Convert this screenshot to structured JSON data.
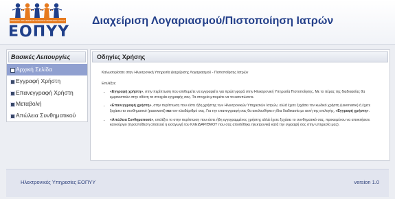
{
  "header": {
    "logo": {
      "band_text": "ΕΘΝΙΚΟΣ ΟΡΓΑΝΙΣΜΟΣ ΠΑΡΟΧΗΣ ΥΠΗΡΕΣΙΩΝ ΥΓΕΙΑΣ",
      "text": "ΕΟΠΥΥ",
      "figure_colors": [
        "#1f3f8a",
        "#e67a1e",
        "#1f3f8a",
        "#e67a1e",
        "#1f3f8a"
      ]
    },
    "title": "Διαχείριση Λογαριασμού/Πιστοποίηση Ιατρών"
  },
  "sidebar": {
    "heading": "Βασικές Λειτουργίες",
    "items": [
      {
        "label": "Αρχική Σελίδα",
        "active": true
      },
      {
        "label": "Εγγραφή Χρήστη",
        "active": false
      },
      {
        "label": "Επανεγγραφή Χρήστη",
        "active": false
      },
      {
        "label": "Μεταβολή",
        "active": false
      },
      {
        "label": "Απώλεια Συνθηματικού",
        "active": false
      }
    ]
  },
  "panel": {
    "heading": "Οδηγίες Χρήσης",
    "welcome": "Καλωσορίσατε στην Ηλεκτρονική Υπηρεσία Διαχείρισης Λογαριασμού - Πιστοποίησης Ιατρών",
    "choose": "Επιλέξτε:",
    "option1": {
      "bold": "«Εγγραφή χρήστη»",
      "text": ", στην περίπτωση που επιθυμείτε να εγγραφείτε για πρώτη φορά στην Ηλεκτρονική Υπηρεσία Πιστοποίησης. Με το πέρας της διαδικασίας θα εμφανιστούν στην οθόνη τα στοιχεία εγγραφής σας. Τα στοιχεία μπορείτε να τα εκτυπώσετε."
    },
    "option2": {
      "bold": "«Επανεγγραφή χρήστη»",
      "text_a": ", στην περίπτωση που είστε ήδη χρήστης των Ηλεκτρονικών Υπηρεσιών Ιατρών, αλλά έχετε ξεχάσει τον κωδικό χρήστη (username) ή έχετε ξεχάσει το συνθηματικό (password) ",
      "bold_and": "και",
      "text_b": " τον κλειδάριθμό σας. Για την επανεγγραφή σας θα ακολουθήσει η ίδια διαδικασία με αυτή της επιλογής, ",
      "bold_ref": "«Εγγραφή χρήστη»",
      "text_c": "."
    },
    "option3": {
      "bold": "«Απώλεια Συνθηματικού»",
      "text": ", επιλέξτε το στην περίπτωση που είστε ήδη εγγεγραμμένος χρήστης αλλά έχετε ξεχάσει το συνθηματικό σας, προκειμένου να αποκτήσετε καινούργιο (προϋπόθεση αποτελεί η εισαγωγή του ΚΛΕΙΔΑΡΙΘΜΟΥ που σας αποδόθηκε ηλεκτρονικά κατά την εγγραφή σας στην υπηρεσία μας)."
    }
  },
  "footer": {
    "left": "Ηλεκτρονικές Υπηρεσίες ΕΟΠΥΥ",
    "right": "version 1.0"
  },
  "colors": {
    "accent": "#24408a",
    "active_item_bg": "#90a0d0",
    "logo_orange": "#e67a1e"
  }
}
